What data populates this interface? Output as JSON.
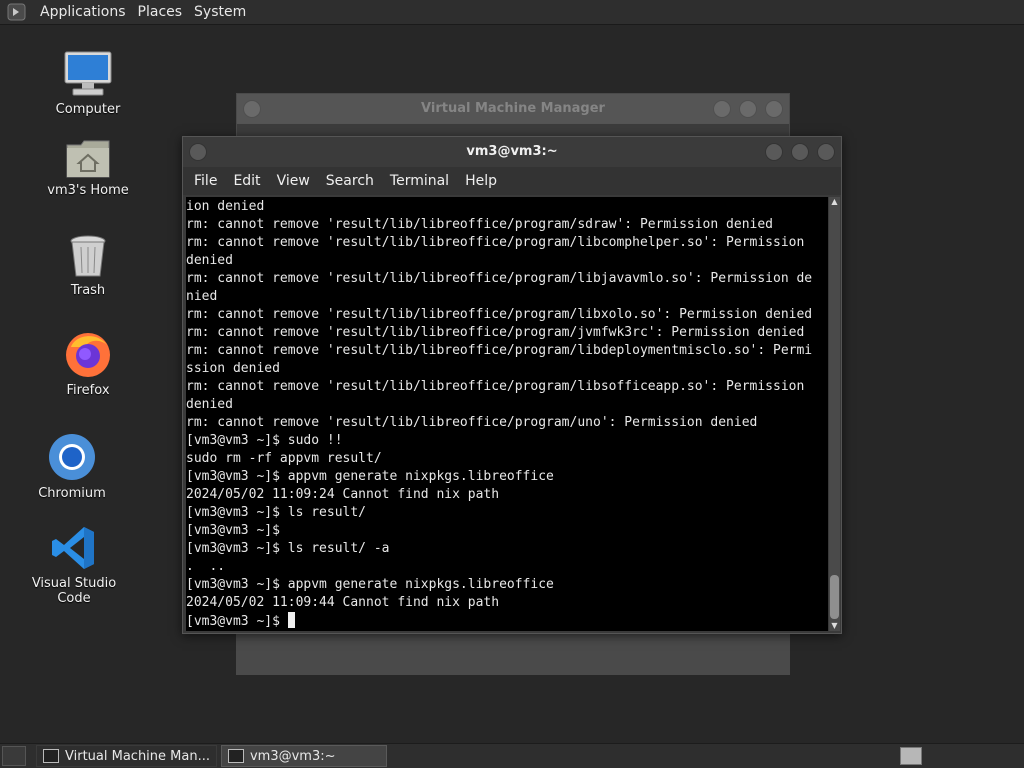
{
  "top_panel": {
    "menus": [
      "Applications",
      "Places",
      "System"
    ]
  },
  "desktop": {
    "icons": [
      {
        "label": "Computer",
        "icon": "computer-icon"
      },
      {
        "label": "vm3's Home",
        "icon": "home-folder-icon"
      },
      {
        "label": "Trash",
        "icon": "trash-icon"
      },
      {
        "label": "Firefox",
        "icon": "firefox-icon"
      },
      {
        "label": "Chromium",
        "icon": "chromium-icon"
      },
      {
        "label": "Visual Studio Code",
        "icon": "vscode-icon"
      }
    ]
  },
  "bg_window": {
    "title": "Virtual Machine Manager"
  },
  "terminal": {
    "title": "vm3@vm3:~",
    "menu": [
      "File",
      "Edit",
      "View",
      "Search",
      "Terminal",
      "Help"
    ],
    "lines": [
      "ion denied",
      "rm: cannot remove 'result/lib/libreoffice/program/sdraw': Permission denied",
      "rm: cannot remove 'result/lib/libreoffice/program/libcomphelper.so': Permission",
      "denied",
      "rm: cannot remove 'result/lib/libreoffice/program/libjavavmlo.so': Permission de",
      "nied",
      "rm: cannot remove 'result/lib/libreoffice/program/libxolo.so': Permission denied",
      "rm: cannot remove 'result/lib/libreoffice/program/jvmfwk3rc': Permission denied",
      "rm: cannot remove 'result/lib/libreoffice/program/libdeploymentmisclo.so': Permi",
      "ssion denied",
      "rm: cannot remove 'result/lib/libreoffice/program/libsofficeapp.so': Permission",
      "denied",
      "rm: cannot remove 'result/lib/libreoffice/program/uno': Permission denied",
      "[vm3@vm3 ~]$ sudo !!",
      "sudo rm -rf appvm result/",
      "[vm3@vm3 ~]$ appvm generate nixpkgs.libreoffice",
      "2024/05/02 11:09:24 Cannot find nix path",
      "[vm3@vm3 ~]$ ls result/",
      "[vm3@vm3 ~]$",
      "[vm3@vm3 ~]$ ls result/ -a",
      ".  ..",
      "[vm3@vm3 ~]$ appvm generate nixpkgs.libreoffice",
      "2024/05/02 11:09:44 Cannot find nix path"
    ],
    "prompt": "[vm3@vm3 ~]$ "
  },
  "taskbar": {
    "tasks": [
      {
        "label": "Virtual Machine Man...",
        "active": false
      },
      {
        "label": "vm3@vm3:~",
        "active": true
      }
    ]
  }
}
